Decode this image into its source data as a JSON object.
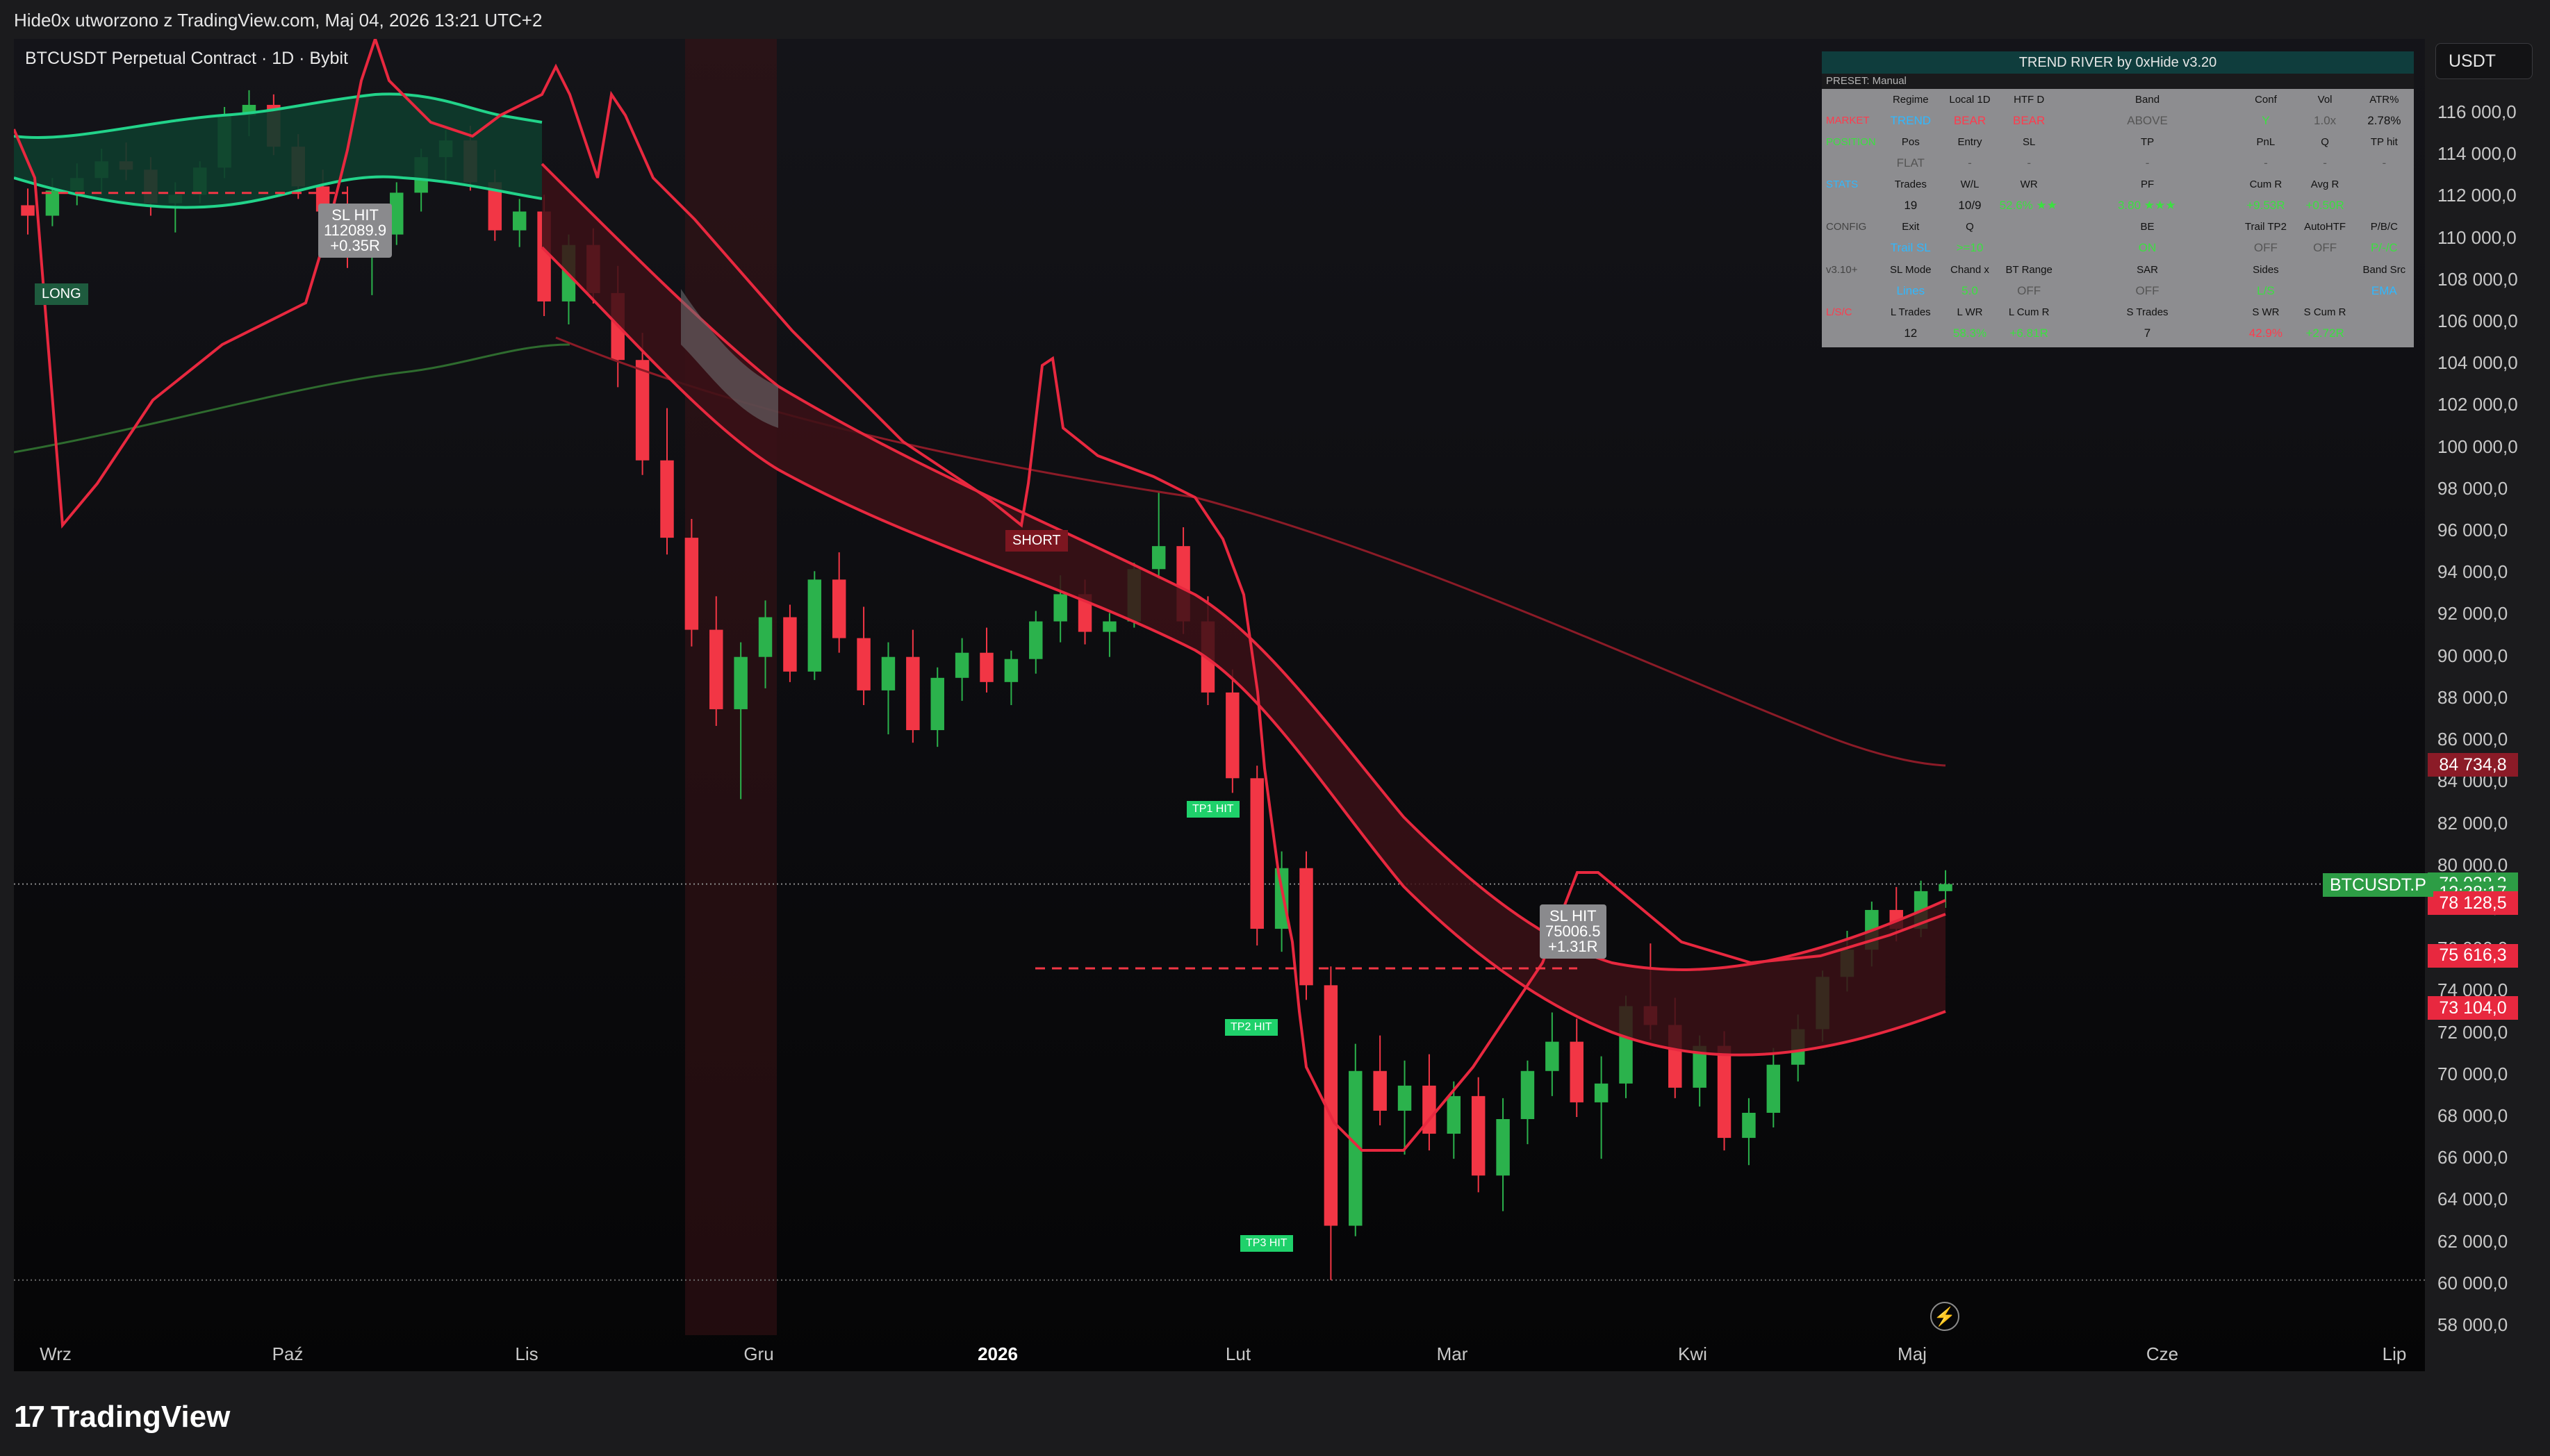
{
  "header": {
    "title": "Hide0x utworzono z TradingView.com, Maj 04, 2026 13:21 UTC+2"
  },
  "symbol_line": "BTCUSDT Perpetual Contract · 1D · Bybit",
  "currency_button": "USDT",
  "brand": {
    "mark": "17",
    "name": "TradingView"
  },
  "price_axis": {
    "ticks": [
      "116 000,0",
      "114 000,0",
      "112 000,0",
      "110 000,0",
      "108 000,0",
      "106 000,0",
      "104 000,0",
      "102 000,0",
      "100 000,0",
      "98 000,0",
      "96 000,0",
      "94 000,0",
      "92 000,0",
      "90 000,0",
      "88 000,0",
      "86 000,0",
      "84 000,0",
      "82 000,0",
      "80 000,0",
      "78 000,0",
      "76 000,0",
      "74 000,0",
      "72 000,0",
      "70 000,0",
      "68 000,0",
      "66 000,0",
      "64 000,0",
      "62 000,0",
      "60 000,0",
      "58 000,0"
    ],
    "tick_values": [
      116000,
      114000,
      112000,
      110000,
      108000,
      106000,
      104000,
      102000,
      100000,
      98000,
      96000,
      94000,
      92000,
      90000,
      88000,
      86000,
      84000,
      82000,
      80000,
      78000,
      76000,
      74000,
      72000,
      70000,
      68000,
      66000,
      64000,
      62000,
      60000,
      58000
    ]
  },
  "time_axis": {
    "labels": [
      "Wrz",
      "Paź",
      "Lis",
      "Gru",
      "2026",
      "Lut",
      "Mar",
      "Kwi",
      "Maj",
      "Cze",
      "Lip"
    ]
  },
  "price_tags": [
    {
      "label": "84 734,8",
      "value": 84734.8,
      "color": "#8b1b27"
    },
    {
      "label": "79 038,3",
      "value": 79038.3,
      "color": "#2d9d45"
    },
    {
      "label": "12:38:17",
      "value": 78600,
      "color": "#2d9d45"
    },
    {
      "label": "78 128,5",
      "value": 78128.5,
      "color": "#e8283f"
    },
    {
      "label": "75 616,3",
      "value": 75616.3,
      "color": "#e8283f"
    },
    {
      "label": "73 104,0",
      "value": 73104.0,
      "color": "#e8283f"
    }
  ],
  "symbol_tag": "BTCUSDT.P",
  "chart_markers": {
    "long": "LONG",
    "short": "SHORT",
    "sl_hit_1": [
      "SL HIT",
      "112089.9",
      "+0.35R"
    ],
    "sl_hit_2": [
      "SL HIT",
      "75006.5",
      "+1.31R"
    ],
    "tp1": "TP1 HIT",
    "tp2": "TP2 HIT",
    "tp3": "TP3 HIT"
  },
  "panel": {
    "title": "TREND RIVER by 0xHide v3.20",
    "preset": "PRESET: Manual",
    "rows": [
      {
        "type": "head",
        "cells": [
          "",
          "Regime",
          "Local 1D",
          "HTF D",
          "",
          "Band",
          "",
          "Conf",
          "Vol",
          "ATR%"
        ]
      },
      {
        "type": "val",
        "cells": [
          "MARKET",
          "TREND",
          "BEAR",
          "BEAR",
          "",
          "ABOVE",
          "",
          "Y",
          "1.0x",
          "2.78%"
        ]
      },
      {
        "type": "head",
        "cells": [
          "POSITION",
          "Pos",
          "Entry",
          "SL",
          "",
          "TP",
          "",
          "PnL",
          "Q",
          "TP hit"
        ]
      },
      {
        "type": "val",
        "cells": [
          "",
          "FLAT",
          "-",
          "-",
          "",
          "-",
          "",
          "-",
          "-",
          "-"
        ]
      },
      {
        "type": "head",
        "cells": [
          "STATS",
          "Trades",
          "W/L",
          "WR",
          "",
          "PF",
          "",
          "Cum R",
          "Avg R",
          ""
        ]
      },
      {
        "type": "val",
        "cells": [
          "",
          "19",
          "10/9",
          "52.6% ★★★☆☆",
          "",
          "3.80 ★★★★★",
          "",
          "+9.53R",
          "+0.50R",
          ""
        ]
      },
      {
        "type": "head",
        "cells": [
          "CONFIG",
          "Exit",
          "Q",
          "",
          "",
          "BE",
          "",
          "Trail TP2",
          "AutoHTF",
          "P/B/C"
        ]
      },
      {
        "type": "val",
        "cells": [
          "",
          "Trail SL",
          ">=10",
          "",
          "",
          "ON",
          "",
          "OFF",
          "OFF",
          "P/-/C"
        ]
      },
      {
        "type": "head",
        "cells": [
          "v3.10+",
          "SL Mode",
          "Chand x",
          "BT Range",
          "",
          "SAR",
          "",
          "Sides",
          "",
          "Band Src"
        ]
      },
      {
        "type": "val",
        "cells": [
          "",
          "Lines",
          "5.0",
          "OFF",
          "",
          "OFF",
          "",
          "L/S",
          "",
          "EMA"
        ]
      },
      {
        "type": "head",
        "cells": [
          "L/S/C",
          "L Trades",
          "L WR",
          "L Cum R",
          "",
          "S Trades",
          "",
          "S WR",
          "S Cum R",
          ""
        ]
      },
      {
        "type": "val",
        "cells": [
          "",
          "12",
          "58.3%",
          "+6.81R",
          "",
          "7",
          "",
          "42.9%",
          "+2.72R",
          ""
        ]
      }
    ]
  },
  "colors": {
    "bull": "#2bb24c",
    "bear": "#f23645",
    "band_green": "#22d38a",
    "band_red": "#e8283f",
    "ema_dark_red": "#8b1b27",
    "ema_green": "#2e6b2e",
    "panel_bg": "#8d8d90",
    "panel_title_bg": "#0f3d3d"
  },
  "chart_data": {
    "type": "candlestick",
    "y_range": [
      58000,
      117000
    ],
    "candles_ohlc": [
      [
        111500,
        112300,
        110100,
        111000
      ],
      [
        111000,
        112800,
        110500,
        112200
      ],
      [
        112200,
        113500,
        111500,
        112800
      ],
      [
        112800,
        114200,
        112000,
        113600
      ],
      [
        113600,
        114500,
        112700,
        113200
      ],
      [
        113200,
        113800,
        111000,
        111600
      ],
      [
        111600,
        112600,
        110200,
        112000
      ],
      [
        112000,
        113600,
        111600,
        113300
      ],
      [
        113300,
        116200,
        112800,
        115800
      ],
      [
        115800,
        117000,
        114800,
        116300
      ],
      [
        116300,
        116800,
        113900,
        114300
      ],
      [
        114300,
        114900,
        111800,
        112400
      ],
      [
        112400,
        113200,
        110500,
        111200
      ],
      [
        111200,
        112400,
        108500,
        109300
      ],
      [
        109300,
        110800,
        107200,
        110100
      ],
      [
        110100,
        112600,
        109600,
        112100
      ],
      [
        112100,
        114200,
        111200,
        113800
      ],
      [
        113800,
        115100,
        112600,
        114600
      ],
      [
        114600,
        115300,
        112200,
        112600
      ],
      [
        112600,
        113200,
        109800,
        110300
      ],
      [
        110300,
        111800,
        109500,
        111200
      ],
      [
        111200,
        112000,
        106200,
        106900
      ],
      [
        106900,
        110100,
        105800,
        109600
      ],
      [
        109600,
        110400,
        106800,
        107300
      ],
      [
        107300,
        108600,
        102800,
        104100
      ],
      [
        104100,
        105400,
        98600,
        99300
      ],
      [
        99300,
        101800,
        94800,
        95600
      ],
      [
        95600,
        96500,
        90400,
        91200
      ],
      [
        91200,
        92800,
        86600,
        87400
      ],
      [
        87400,
        90600,
        83100,
        89900
      ],
      [
        89900,
        92600,
        88400,
        91800
      ],
      [
        91800,
        92400,
        88700,
        89200
      ],
      [
        89200,
        94000,
        88800,
        93600
      ],
      [
        93600,
        94900,
        90100,
        90800
      ],
      [
        90800,
        92300,
        87600,
        88300
      ],
      [
        88300,
        90600,
        86200,
        89900
      ],
      [
        89900,
        91200,
        85800,
        86400
      ],
      [
        86400,
        89400,
        85600,
        88900
      ],
      [
        88900,
        90800,
        87800,
        90100
      ],
      [
        90100,
        91300,
        88200,
        88700
      ],
      [
        88700,
        90200,
        87600,
        89800
      ],
      [
        89800,
        92100,
        89100,
        91600
      ],
      [
        91600,
        93800,
        90600,
        92900
      ],
      [
        92900,
        93600,
        90500,
        91100
      ],
      [
        91100,
        92000,
        89900,
        91600
      ],
      [
        91600,
        94400,
        91300,
        94100
      ],
      [
        94100,
        97800,
        93600,
        95200
      ],
      [
        95200,
        96100,
        91000,
        91600
      ],
      [
        91600,
        92800,
        87600,
        88200
      ],
      [
        88200,
        89300,
        83400,
        84100
      ],
      [
        84100,
        84700,
        76100,
        76900
      ],
      [
        76900,
        80600,
        75800,
        79800
      ],
      [
        79800,
        80600,
        73500,
        74200
      ],
      [
        74200,
        75100,
        60100,
        62700
      ],
      [
        62700,
        71400,
        62200,
        70100
      ],
      [
        70100,
        71800,
        67500,
        68200
      ],
      [
        68200,
        70600,
        66100,
        69400
      ],
      [
        69400,
        70900,
        66300,
        67100
      ],
      [
        67100,
        69600,
        65900,
        68900
      ],
      [
        68900,
        69800,
        64300,
        65100
      ],
      [
        65100,
        68800,
        63400,
        67800
      ],
      [
        67800,
        70600,
        66600,
        70100
      ],
      [
        70100,
        72900,
        68900,
        71500
      ],
      [
        71500,
        72600,
        67900,
        68600
      ],
      [
        68600,
        70800,
        65900,
        69500
      ],
      [
        69500,
        73700,
        68800,
        73200
      ],
      [
        73200,
        76200,
        71600,
        72300
      ],
      [
        72300,
        73600,
        68800,
        69300
      ],
      [
        69300,
        71800,
        68400,
        71300
      ],
      [
        71300,
        72000,
        66300,
        66900
      ],
      [
        66900,
        68800,
        65600,
        68100
      ],
      [
        68100,
        71200,
        67400,
        70400
      ],
      [
        70400,
        72800,
        69600,
        72100
      ],
      [
        72100,
        74900,
        71500,
        74600
      ],
      [
        74600,
        76800,
        73900,
        75900
      ],
      [
        75900,
        78200,
        75100,
        77800
      ],
      [
        77800,
        78900,
        76300,
        76900
      ],
      [
        76900,
        79200,
        76500,
        78700
      ],
      [
        78700,
        79700,
        77900,
        79038
      ]
    ]
  }
}
